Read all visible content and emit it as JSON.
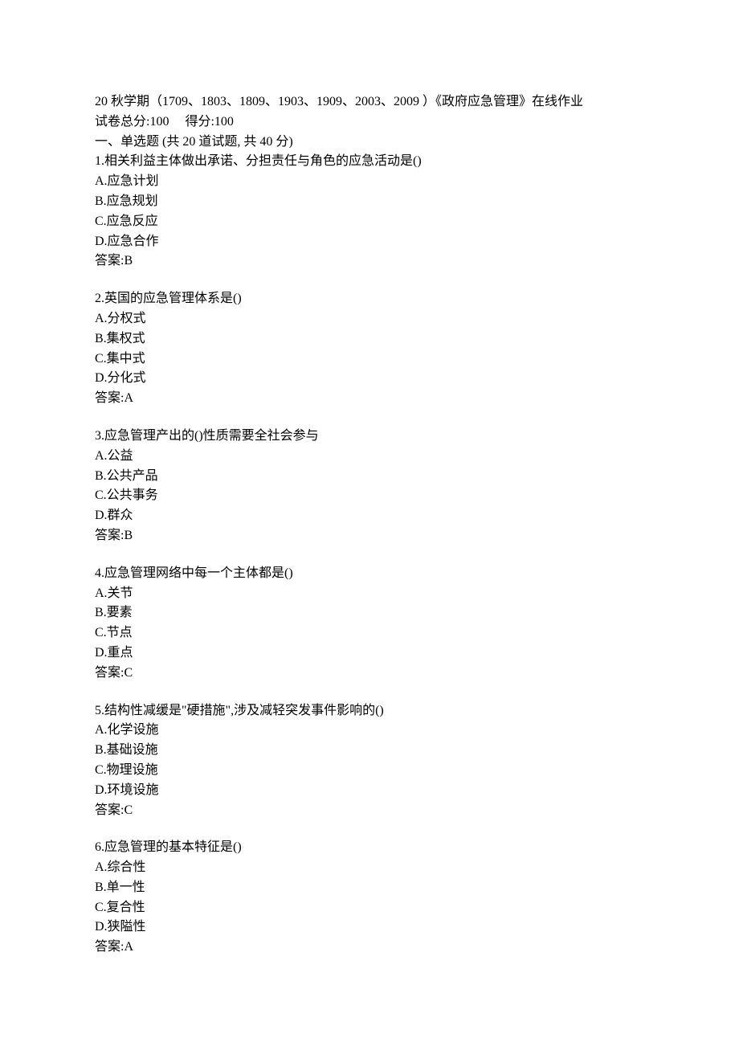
{
  "header": {
    "title_line": "20 秋学期（1709、1803、1809、1903、1909、2003、2009 ）《政府应急管理》在线作业",
    "score_line_prefix": "试卷总分:100",
    "score_line_suffix": "得分:100",
    "section_title": "一、单选题 (共 20 道试题, 共 40 分)"
  },
  "questions": [
    {
      "q": "1.相关利益主体做出承诺、分担责任与角色的应急活动是()",
      "opts": [
        "A.应急计划",
        "B.应急规划",
        "C.应急反应",
        "D.应急合作"
      ],
      "ans": "答案:B"
    },
    {
      "q": "2.英国的应急管理体系是()",
      "opts": [
        "A.分权式",
        "B.集权式",
        "C.集中式",
        "D.分化式"
      ],
      "ans": "答案:A"
    },
    {
      "q": "3.应急管理产出的()性质需要全社会参与",
      "opts": [
        "A.公益",
        "B.公共产品",
        "C.公共事务",
        "D.群众"
      ],
      "ans": "答案:B"
    },
    {
      "q": "4.应急管理网络中每一个主体都是()",
      "opts": [
        "A.关节",
        "B.要素",
        "C.节点",
        "D.重点"
      ],
      "ans": "答案:C"
    },
    {
      "q": "5.结构性减缓是\"硬措施\",涉及减轻突发事件影响的()",
      "opts": [
        "A.化学设施",
        "B.基础设施",
        "C.物理设施",
        "D.环境设施"
      ],
      "ans": "答案:C"
    },
    {
      "q": "6.应急管理的基本特征是()",
      "opts": [
        "A.综合性",
        "B.单一性",
        "C.复合性",
        "D.狭隘性"
      ],
      "ans": "答案:A"
    }
  ]
}
